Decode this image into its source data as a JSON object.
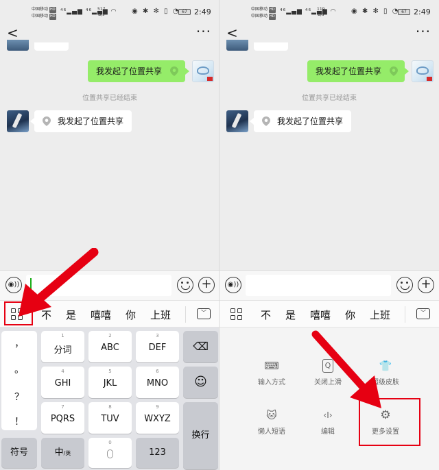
{
  "status_left": {
    "carrier1": "中国移动",
    "carrier2": "中国移动",
    "hd": "HD",
    "speed_value": "517",
    "speed_unit": "B/s",
    "battery": "67",
    "time": "2:49"
  },
  "status_right": {
    "carrier1": "中国移动",
    "carrier2": "中国移动",
    "hd": "HD",
    "speed_value": "119",
    "speed_unit": "B/s",
    "battery": "67",
    "time": "2:49"
  },
  "nav": {
    "back_icon": "chevron-left-icon",
    "more_icon": "ellipsis-icon",
    "more": "···",
    "back": "<"
  },
  "chat": {
    "sent_message": "我发起了位置共享",
    "system_notice": "位置共享已经结束",
    "received_message": "我发起了位置共享"
  },
  "input_bar": {
    "voice_icon": "voice-icon",
    "voice_glyph": "◉))",
    "plus_glyph": "+"
  },
  "candidates": [
    "不",
    "是",
    "嘻嘻",
    "你",
    "上班"
  ],
  "keyboard": {
    "punctuation": [
      "，",
      "。",
      "？",
      "！"
    ],
    "rows": [
      [
        {
          "num": "1",
          "label": "分词"
        },
        {
          "num": "2",
          "label": "ABC"
        },
        {
          "num": "3",
          "label": "DEF"
        }
      ],
      [
        {
          "num": "4",
          "label": "GHI"
        },
        {
          "num": "5",
          "label": "JKL"
        },
        {
          "num": "6",
          "label": "MNO"
        }
      ],
      [
        {
          "num": "7",
          "label": "PQRS"
        },
        {
          "num": "8",
          "label": "TUV"
        },
        {
          "num": "9",
          "label": "WXYZ"
        }
      ]
    ],
    "delete_glyph": "⌫",
    "emoji_glyph": "☺",
    "enter": "换行",
    "symbols": "符号",
    "lang_main": "中",
    "lang_sub": "/英",
    "zero": "0",
    "num_mode": "123"
  },
  "tools": [
    {
      "label": "输入方式",
      "icon": "keyboard-icon",
      "glyph": "⌨"
    },
    {
      "label": "关闭上滑",
      "icon": "swipe-q-icon",
      "glyph": "Q"
    },
    {
      "label": "超级皮肤",
      "icon": "tshirt-icon",
      "glyph": "👕"
    },
    {
      "label": "懒人短语",
      "icon": "lazy-cat-icon",
      "glyph": "🐱"
    },
    {
      "label": "编辑",
      "icon": "edit-cursor-icon",
      "glyph": "‹I›"
    },
    {
      "label": "更多设置",
      "icon": "gear-icon",
      "glyph": "⚙"
    }
  ],
  "colors": {
    "annotation_red": "#e60012",
    "bubble_green": "#95ec69",
    "wechat_green": "#1aad19"
  }
}
